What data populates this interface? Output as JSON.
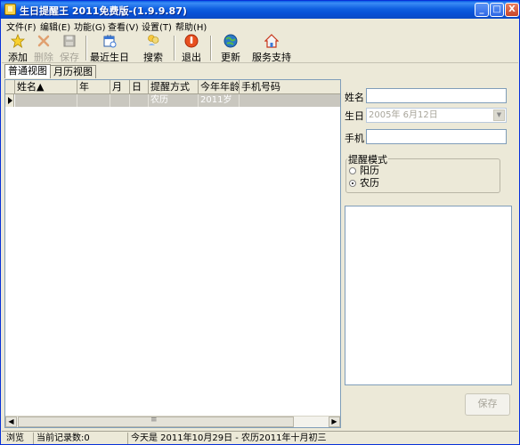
{
  "window": {
    "title": "生日提醒王 2011免费版-(1.9.9.87)",
    "controls": {
      "minimize": "_",
      "maximize": "□",
      "close": "X"
    }
  },
  "menu": [
    "文件(F)",
    "编辑(E)",
    "功能(G)",
    "查看(V)",
    "设置(T)",
    "帮助(H)"
  ],
  "toolbar": [
    {
      "label": "添加",
      "icon": "star-icon",
      "enabled": true
    },
    {
      "label": "删除",
      "icon": "delete-x-icon",
      "enabled": false
    },
    {
      "label": "保存",
      "icon": "floppy-save-icon",
      "enabled": false
    },
    {
      "label": "最近生日",
      "icon": "calendar-recent-icon",
      "enabled": true
    },
    {
      "label": "搜索",
      "icon": "search-people-icon",
      "enabled": true
    },
    {
      "label": "退出",
      "icon": "power-exit-icon",
      "enabled": true
    },
    {
      "label": "更新",
      "icon": "globe-update-icon",
      "enabled": true
    },
    {
      "label": "服务支持",
      "icon": "home-support-icon",
      "enabled": true
    }
  ],
  "tabs": [
    {
      "label": "普通视图",
      "active": true
    },
    {
      "label": "月历视图",
      "active": false
    }
  ],
  "grid": {
    "columns": [
      "姓名▲",
      "年",
      "月",
      "日",
      "提醒方式",
      "今年年龄",
      "手机号码"
    ],
    "rows": [
      [
        "",
        "",
        "",
        "",
        "农历",
        "2011岁",
        ""
      ]
    ]
  },
  "form": {
    "name_label": "姓名",
    "birthday_label": "生日",
    "birthday_value": "2005年  6月12日",
    "phone_label": "手机",
    "mode_title": "提醒模式",
    "modes": [
      {
        "label": "阳历",
        "selected": false
      },
      {
        "label": "农历",
        "selected": true
      }
    ],
    "save_label": "保存"
  },
  "status": {
    "mode": "浏览",
    "count": "当前记录数:0",
    "today": "今天是 2011年10月29日 - 农历2011年十月初三"
  }
}
